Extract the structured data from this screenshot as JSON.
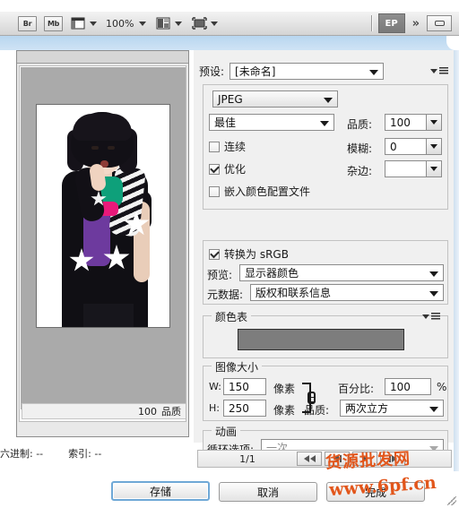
{
  "toolbar": {
    "bridge_label": "Br",
    "device_central_label": "Mb",
    "zoom_value": "100%",
    "workspace_label": "EP",
    "overflow_label": "»"
  },
  "preview": {
    "quality_value": "100",
    "quality_label": "品质"
  },
  "statusbar": {
    "hex_label": "六进制: --",
    "index_label": "索引: --"
  },
  "settings": {
    "preset_label": "预设:",
    "preset_value": "[未命名]",
    "format_value": "JPEG",
    "quality_preset_value": "最佳",
    "quality_label": "品质:",
    "quality_value": "100",
    "blur_label": "模糊:",
    "blur_value": "0",
    "matte_label": "杂边:",
    "matte_value": "",
    "progressive_label": "连续",
    "progressive_checked": false,
    "optimized_label": "优化",
    "optimized_checked": true,
    "embed_profile_label": "嵌入颜色配置文件",
    "embed_profile_checked": false,
    "convert_srgb_label": "转换为  sRGB",
    "convert_srgb_checked": true,
    "preview_label": "预览:",
    "preview_value": "显示器颜色",
    "metadata_label": "元数据:",
    "metadata_value": "版权和联系信息"
  },
  "color_table": {
    "title": "颜色表",
    "swatch_color": "#7d7d7d"
  },
  "image_size": {
    "title": "图像大小",
    "w_label": "W:",
    "w_value": "150",
    "w_unit": "像素",
    "h_label": "H:",
    "h_value": "250",
    "h_unit": "像素",
    "percent_label": "百分比:",
    "percent_value": "100",
    "percent_unit": "%",
    "quality_label": "品质:",
    "quality_value": "两次立方"
  },
  "animation": {
    "title": "动画",
    "loop_label": "循环选项:",
    "loop_value": "一次",
    "frame_counter": "1/1"
  },
  "buttons": {
    "save": "存储",
    "cancel": "取消",
    "done": "完成"
  },
  "watermarks": {
    "top": "货源批发网",
    "bottom": "www.6pf.cn"
  }
}
